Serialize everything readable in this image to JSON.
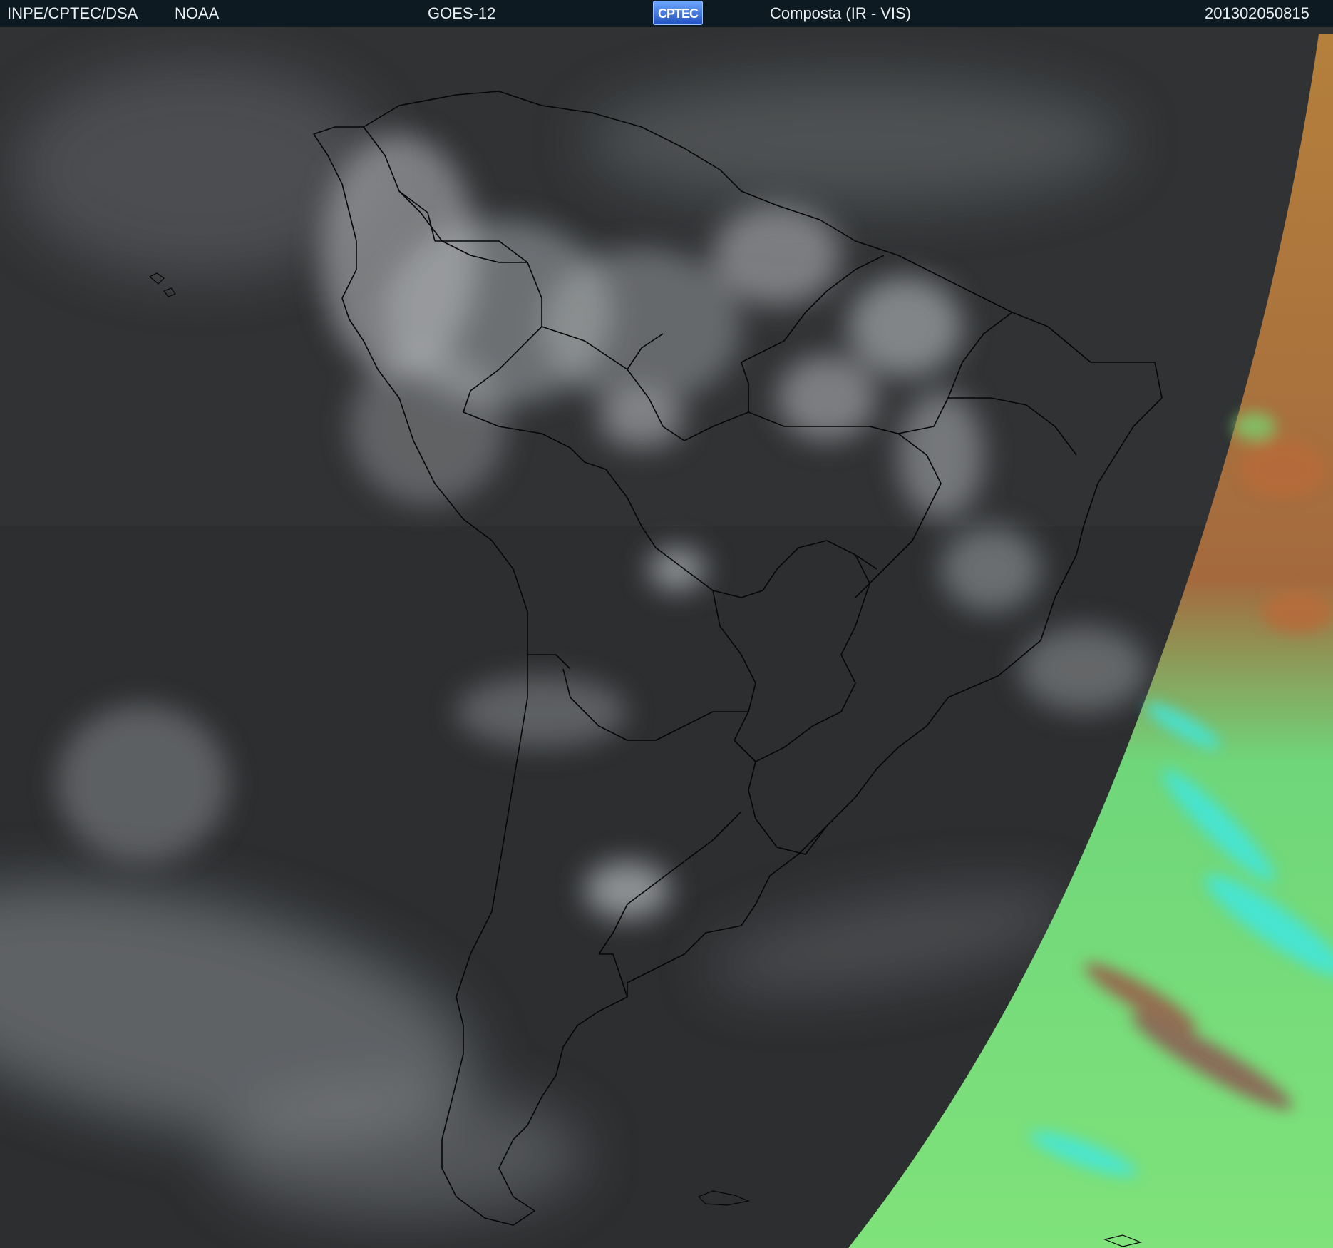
{
  "header": {
    "institution": "INPE/CPTEC/DSA",
    "agency": "NOAA",
    "satellite": "GOES-12",
    "logo_text": "CPTEC",
    "product": "Composta (IR - VIS)",
    "timestamp": "201302050815"
  },
  "colors": {
    "header_bg": "#0e1a22",
    "header_text": "#e8eef2",
    "ir_background": "#2b2d2f",
    "cloud_white": "#d8dadc",
    "vis_green": "#7fe27a",
    "vis_orange": "#c07a3c",
    "vis_cyan": "#40e6e0",
    "border_lines": "#050607"
  }
}
